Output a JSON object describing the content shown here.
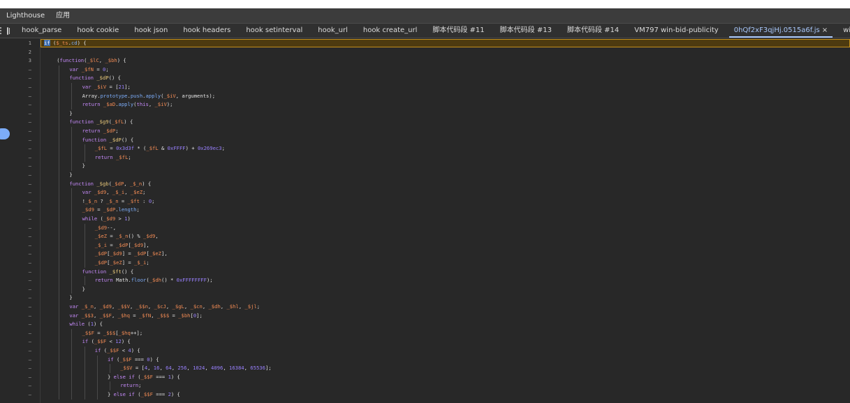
{
  "top_tabs": [
    "Lighthouse",
    "应用"
  ],
  "file_tabs": [
    {
      "label": "hook_parse"
    },
    {
      "label": "hook cookie"
    },
    {
      "label": "hook json"
    },
    {
      "label": "hook headers"
    },
    {
      "label": "hook setinterval"
    },
    {
      "label": "hook_url"
    },
    {
      "label": "hook create_url"
    },
    {
      "label": "脚本代码段 #11"
    },
    {
      "label": "脚本代码段 #13"
    },
    {
      "label": "脚本代码段 #14"
    },
    {
      "label": "VM797 win-bid-publicity"
    },
    {
      "label": "0hQf2xF3qjHj.0515a6f.js",
      "active": true,
      "close": "×"
    },
    {
      "label": "win-bid-publicity"
    }
  ],
  "colors": {
    "background": "#282828",
    "tab_active": "#a8c7fa",
    "highlight_line_border": "#c48f1c",
    "keyword": "#c58af9",
    "identifier": "#f28b54"
  },
  "code_lines": [
    {
      "ln": "1",
      "indent": 0,
      "tokens": [
        [
          "sel",
          "if"
        ],
        [
          "t",
          " ("
        ],
        [
          "id",
          "$_ts"
        ],
        [
          "t",
          "."
        ],
        [
          "prop",
          "cd"
        ],
        [
          "t",
          ") {"
        ]
      ]
    },
    {
      "ln": "2",
      "indent": 0,
      "tokens": []
    },
    {
      "ln": "3",
      "indent": 1,
      "tokens": [
        [
          "t",
          "("
        ],
        [
          "kw",
          "function"
        ],
        [
          "t",
          "("
        ],
        [
          "id",
          "_$lC"
        ],
        [
          "t",
          ", "
        ],
        [
          "id",
          "_$bh"
        ],
        [
          "t",
          ") {"
        ]
      ]
    },
    {
      "ln": "–",
      "indent": 2,
      "tokens": [
        [
          "kw",
          "var"
        ],
        [
          "t",
          " "
        ],
        [
          "id",
          "_$fN"
        ],
        [
          "t",
          " = "
        ],
        [
          "num",
          "0"
        ],
        [
          "t",
          ";"
        ]
      ]
    },
    {
      "ln": "–",
      "indent": 2,
      "tokens": [
        [
          "kw",
          "function"
        ],
        [
          "t",
          " "
        ],
        [
          "fn",
          "_$dP"
        ],
        [
          "t",
          "() {"
        ]
      ]
    },
    {
      "ln": "–",
      "indent": 3,
      "tokens": [
        [
          "kw",
          "var"
        ],
        [
          "t",
          " "
        ],
        [
          "id",
          "_$iV"
        ],
        [
          "t",
          " = ["
        ],
        [
          "num",
          "21"
        ],
        [
          "t",
          "];"
        ]
      ]
    },
    {
      "ln": "–",
      "indent": 3,
      "tokens": [
        [
          "t",
          "Array."
        ],
        [
          "prop",
          "prototype"
        ],
        [
          "t",
          "."
        ],
        [
          "prop",
          "push"
        ],
        [
          "t",
          "."
        ],
        [
          "prop",
          "apply"
        ],
        [
          "t",
          "("
        ],
        [
          "id",
          "_$iV"
        ],
        [
          "t",
          ", arguments);"
        ]
      ]
    },
    {
      "ln": "–",
      "indent": 3,
      "tokens": [
        [
          "kw",
          "return"
        ],
        [
          "t",
          " "
        ],
        [
          "id",
          "_$aD"
        ],
        [
          "t",
          "."
        ],
        [
          "prop",
          "apply"
        ],
        [
          "t",
          "("
        ],
        [
          "kw",
          "this"
        ],
        [
          "t",
          ", "
        ],
        [
          "id",
          "_$iV"
        ],
        [
          "t",
          ");"
        ]
      ]
    },
    {
      "ln": "–",
      "indent": 2,
      "tokens": [
        [
          "t",
          "}"
        ]
      ]
    },
    {
      "ln": "–",
      "indent": 2,
      "tokens": [
        [
          "kw",
          "function"
        ],
        [
          "t",
          " "
        ],
        [
          "fn",
          "_$g9"
        ],
        [
          "t",
          "("
        ],
        [
          "id",
          "_$fL"
        ],
        [
          "t",
          ") {"
        ]
      ]
    },
    {
      "ln": "–",
      "indent": 3,
      "tokens": [
        [
          "kw",
          "return"
        ],
        [
          "t",
          " "
        ],
        [
          "id",
          "_$dP"
        ],
        [
          "t",
          ";"
        ]
      ]
    },
    {
      "ln": "–",
      "indent": 3,
      "tokens": [
        [
          "kw",
          "function"
        ],
        [
          "t",
          " "
        ],
        [
          "fn",
          "_$dP"
        ],
        [
          "t",
          "() {"
        ]
      ]
    },
    {
      "ln": "–",
      "indent": 4,
      "tokens": [
        [
          "id",
          "_$fL"
        ],
        [
          "t",
          " = "
        ],
        [
          "num",
          "0x3d3f"
        ],
        [
          "t",
          " * ("
        ],
        [
          "id",
          "_$fL"
        ],
        [
          "t",
          " & "
        ],
        [
          "num",
          "0xFFFF"
        ],
        [
          "t",
          ") + "
        ],
        [
          "num",
          "0x269ec3"
        ],
        [
          "t",
          ";"
        ]
      ]
    },
    {
      "ln": "–",
      "indent": 4,
      "tokens": [
        [
          "kw",
          "return"
        ],
        [
          "t",
          " "
        ],
        [
          "id",
          "_$fL"
        ],
        [
          "t",
          ";"
        ]
      ]
    },
    {
      "ln": "–",
      "indent": 3,
      "tokens": [
        [
          "t",
          "}"
        ]
      ]
    },
    {
      "ln": "–",
      "indent": 2,
      "tokens": [
        [
          "t",
          "}"
        ]
      ]
    },
    {
      "ln": "–",
      "indent": 2,
      "tokens": [
        [
          "kw",
          "function"
        ],
        [
          "t",
          " "
        ],
        [
          "fn",
          "_$gb"
        ],
        [
          "t",
          "("
        ],
        [
          "id",
          "_$dP"
        ],
        [
          "t",
          ", "
        ],
        [
          "id",
          "_$_n"
        ],
        [
          "t",
          ") {"
        ]
      ]
    },
    {
      "ln": "–",
      "indent": 3,
      "tokens": [
        [
          "kw",
          "var"
        ],
        [
          "t",
          " "
        ],
        [
          "id",
          "_$d9"
        ],
        [
          "t",
          ", "
        ],
        [
          "id",
          "_$_i"
        ],
        [
          "t",
          ", "
        ],
        [
          "id",
          "_$eZ"
        ],
        [
          "t",
          ";"
        ]
      ]
    },
    {
      "ln": "–",
      "indent": 3,
      "tokens": [
        [
          "t",
          "!"
        ],
        [
          "id",
          "_$_n"
        ],
        [
          "t",
          " ? "
        ],
        [
          "id",
          "_$_n"
        ],
        [
          "t",
          " = "
        ],
        [
          "id",
          "_$ft"
        ],
        [
          "t",
          " : "
        ],
        [
          "num",
          "0"
        ],
        [
          "t",
          ";"
        ]
      ]
    },
    {
      "ln": "–",
      "indent": 3,
      "tokens": [
        [
          "id",
          "_$d9"
        ],
        [
          "t",
          " = "
        ],
        [
          "id",
          "_$dP"
        ],
        [
          "t",
          "."
        ],
        [
          "prop",
          "length"
        ],
        [
          "t",
          ";"
        ]
      ]
    },
    {
      "ln": "–",
      "indent": 3,
      "tokens": [
        [
          "kw",
          "while"
        ],
        [
          "t",
          " ("
        ],
        [
          "id",
          "_$d9"
        ],
        [
          "t",
          " > "
        ],
        [
          "num",
          "1"
        ],
        [
          "t",
          ")"
        ]
      ]
    },
    {
      "ln": "–",
      "indent": 4,
      "tokens": [
        [
          "id",
          "_$d9"
        ],
        [
          "t",
          "--,"
        ]
      ]
    },
    {
      "ln": "–",
      "indent": 4,
      "tokens": [
        [
          "id",
          "_$eZ"
        ],
        [
          "t",
          " = "
        ],
        [
          "id",
          "_$_n"
        ],
        [
          "t",
          "() % "
        ],
        [
          "id",
          "_$d9"
        ],
        [
          "t",
          ","
        ]
      ]
    },
    {
      "ln": "–",
      "indent": 4,
      "tokens": [
        [
          "id",
          "_$_i"
        ],
        [
          "t",
          " = "
        ],
        [
          "id",
          "_$dP"
        ],
        [
          "t",
          "["
        ],
        [
          "id",
          "_$d9"
        ],
        [
          "t",
          "],"
        ]
      ]
    },
    {
      "ln": "–",
      "indent": 4,
      "tokens": [
        [
          "id",
          "_$dP"
        ],
        [
          "t",
          "["
        ],
        [
          "id",
          "_$d9"
        ],
        [
          "t",
          "] = "
        ],
        [
          "id",
          "_$dP"
        ],
        [
          "t",
          "["
        ],
        [
          "id",
          "_$eZ"
        ],
        [
          "t",
          "],"
        ]
      ]
    },
    {
      "ln": "–",
      "indent": 4,
      "tokens": [
        [
          "id",
          "_$dP"
        ],
        [
          "t",
          "["
        ],
        [
          "id",
          "_$eZ"
        ],
        [
          "t",
          "] = "
        ],
        [
          "id",
          "_$_i"
        ],
        [
          "t",
          ";"
        ]
      ]
    },
    {
      "ln": "–",
      "indent": 3,
      "tokens": [
        [
          "kw",
          "function"
        ],
        [
          "t",
          " "
        ],
        [
          "fn",
          "_$ft"
        ],
        [
          "t",
          "() {"
        ]
      ]
    },
    {
      "ln": "–",
      "indent": 4,
      "tokens": [
        [
          "kw",
          "return"
        ],
        [
          "t",
          " Math."
        ],
        [
          "prop",
          "floor"
        ],
        [
          "t",
          "("
        ],
        [
          "id",
          "_$dh"
        ],
        [
          "t",
          "() * "
        ],
        [
          "num",
          "0xFFFFFFFF"
        ],
        [
          "t",
          ");"
        ]
      ]
    },
    {
      "ln": "–",
      "indent": 3,
      "tokens": [
        [
          "t",
          "}"
        ]
      ]
    },
    {
      "ln": "–",
      "indent": 2,
      "tokens": [
        [
          "t",
          "}"
        ]
      ]
    },
    {
      "ln": "–",
      "indent": 2,
      "tokens": [
        [
          "kw",
          "var"
        ],
        [
          "t",
          " "
        ],
        [
          "id",
          "_$_n"
        ],
        [
          "t",
          ", "
        ],
        [
          "id",
          "_$d9"
        ],
        [
          "t",
          ", "
        ],
        [
          "id",
          "_$$V"
        ],
        [
          "t",
          ", "
        ],
        [
          "id",
          "_$$n"
        ],
        [
          "t",
          ", "
        ],
        [
          "id",
          "_$cJ"
        ],
        [
          "t",
          ", "
        ],
        [
          "id",
          "_$gL"
        ],
        [
          "t",
          ", "
        ],
        [
          "id",
          "_$cn"
        ],
        [
          "t",
          ", "
        ],
        [
          "id",
          "_$dh"
        ],
        [
          "t",
          ", "
        ],
        [
          "id",
          "_$hl"
        ],
        [
          "t",
          ", "
        ],
        [
          "id",
          "_$jl"
        ],
        [
          "t",
          ";"
        ]
      ]
    },
    {
      "ln": "–",
      "indent": 2,
      "tokens": [
        [
          "kw",
          "var"
        ],
        [
          "t",
          " "
        ],
        [
          "id",
          "_$$3"
        ],
        [
          "t",
          ", "
        ],
        [
          "id",
          "_$$F"
        ],
        [
          "t",
          ", "
        ],
        [
          "id",
          "_$hq"
        ],
        [
          "t",
          " = "
        ],
        [
          "id",
          "_$fN"
        ],
        [
          "t",
          ", "
        ],
        [
          "id",
          "_$$$"
        ],
        [
          "t",
          " = "
        ],
        [
          "id",
          "_$bh"
        ],
        [
          "t",
          "["
        ],
        [
          "num",
          "0"
        ],
        [
          "t",
          "];"
        ]
      ]
    },
    {
      "ln": "–",
      "indent": 2,
      "tokens": [
        [
          "kw",
          "while"
        ],
        [
          "t",
          " ("
        ],
        [
          "num",
          "1"
        ],
        [
          "t",
          ") {"
        ]
      ]
    },
    {
      "ln": "–",
      "indent": 3,
      "tokens": [
        [
          "id",
          "_$$F"
        ],
        [
          "t",
          " = "
        ],
        [
          "id",
          "_$$$"
        ],
        [
          "t",
          "["
        ],
        [
          "id",
          "_$hq"
        ],
        [
          "t",
          "++];"
        ]
      ]
    },
    {
      "ln": "–",
      "indent": 3,
      "tokens": [
        [
          "kw",
          "if"
        ],
        [
          "t",
          " ("
        ],
        [
          "id",
          "_$$F"
        ],
        [
          "t",
          " < "
        ],
        [
          "num",
          "12"
        ],
        [
          "t",
          ") {"
        ]
      ]
    },
    {
      "ln": "–",
      "indent": 4,
      "tokens": [
        [
          "kw",
          "if"
        ],
        [
          "t",
          " ("
        ],
        [
          "id",
          "_$$F"
        ],
        [
          "t",
          " < "
        ],
        [
          "num",
          "4"
        ],
        [
          "t",
          ") {"
        ]
      ]
    },
    {
      "ln": "–",
      "indent": 5,
      "tokens": [
        [
          "kw",
          "if"
        ],
        [
          "t",
          " ("
        ],
        [
          "id",
          "_$$F"
        ],
        [
          "t",
          " === "
        ],
        [
          "num",
          "0"
        ],
        [
          "t",
          ") {"
        ]
      ]
    },
    {
      "ln": "–",
      "indent": 6,
      "tokens": [
        [
          "id",
          "_$$V"
        ],
        [
          "t",
          " = ["
        ],
        [
          "num",
          "4"
        ],
        [
          "t",
          ", "
        ],
        [
          "num",
          "16"
        ],
        [
          "t",
          ", "
        ],
        [
          "num",
          "64"
        ],
        [
          "t",
          ", "
        ],
        [
          "num",
          "256"
        ],
        [
          "t",
          ", "
        ],
        [
          "num",
          "1024"
        ],
        [
          "t",
          ", "
        ],
        [
          "num",
          "4096"
        ],
        [
          "t",
          ", "
        ],
        [
          "num",
          "16384"
        ],
        [
          "t",
          ", "
        ],
        [
          "num",
          "65536"
        ],
        [
          "t",
          "];"
        ]
      ]
    },
    {
      "ln": "–",
      "indent": 5,
      "tokens": [
        [
          "t",
          "} "
        ],
        [
          "kw",
          "else if"
        ],
        [
          "t",
          " ("
        ],
        [
          "id",
          "_$$F"
        ],
        [
          "t",
          " === "
        ],
        [
          "num",
          "1"
        ],
        [
          "t",
          ") {"
        ]
      ]
    },
    {
      "ln": "–",
      "indent": 6,
      "tokens": [
        [
          "kw",
          "return"
        ],
        [
          "t",
          ";"
        ]
      ]
    },
    {
      "ln": "–",
      "indent": 5,
      "tokens": [
        [
          "t",
          "} "
        ],
        [
          "kw",
          "else if"
        ],
        [
          "t",
          " ("
        ],
        [
          "id",
          "_$$F"
        ],
        [
          "t",
          " === "
        ],
        [
          "num",
          "2"
        ],
        [
          "t",
          ") {"
        ]
      ]
    }
  ]
}
